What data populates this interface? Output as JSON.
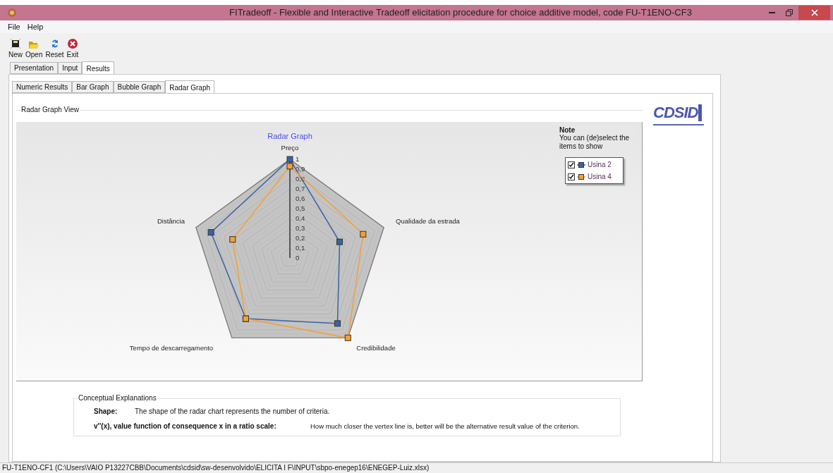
{
  "window": {
    "title": "FITradeoff - Flexible and Interactive Tradeoff elicitation  procedure for choice additive model, code FU-T1ENO-CF3"
  },
  "menu": [
    "File",
    "Help"
  ],
  "toolbar": [
    "New",
    "Open",
    "Reset",
    "Exit"
  ],
  "tabs": [
    {
      "label": "Presentation",
      "selected": false
    },
    {
      "label": "Input",
      "selected": false
    },
    {
      "label": "Results",
      "selected": true
    }
  ],
  "subtabs": [
    {
      "label": "Numeric Results",
      "selected": false
    },
    {
      "label": "Bar Graph",
      "selected": false
    },
    {
      "label": "Bubble Graph",
      "selected": false
    },
    {
      "label": "Radar Graph",
      "selected": true
    }
  ],
  "group_title": "Radar Graph View",
  "logo_text": "CDSID",
  "radar": {
    "title": "Radar Graph",
    "axes": [
      "Preço",
      "Distância",
      "Qualidade da estrada",
      "Tempo de descarregamento",
      "Credibilidade"
    ],
    "ticks": [
      "1",
      "0,9",
      "0,8",
      "0,7",
      "0,6",
      "0,5",
      "0,4",
      "0,3",
      "0,2",
      "0,1",
      "0"
    ],
    "series": [
      {
        "name": "Usina 2",
        "color": "#3a62a6",
        "checked": true
      },
      {
        "name": "Usina 4",
        "color": "#f5a033",
        "checked": true
      }
    ]
  },
  "note": {
    "title": "Note",
    "text": "You can (de)select the items to show"
  },
  "explanations": {
    "title": "Conceptual Explanations",
    "rows": [
      {
        "term": "Shape:",
        "text": "The shape of the radar chart represents the number of criteria."
      },
      {
        "term": "v''(x), value function of consequence x in a ratio scale:",
        "text": "How much closer the vertex line is, better will be the alternative result value of the criterion."
      }
    ]
  },
  "status_bar": "FU-T1ENO-CF1 (C:\\Users\\VAIO P13227CBB\\Documents\\cdsid\\sw-desenvolvido\\ELICITA I F\\INPUT\\sbpo-enegep16\\ENEGEP-Luiz.xlsx)"
}
